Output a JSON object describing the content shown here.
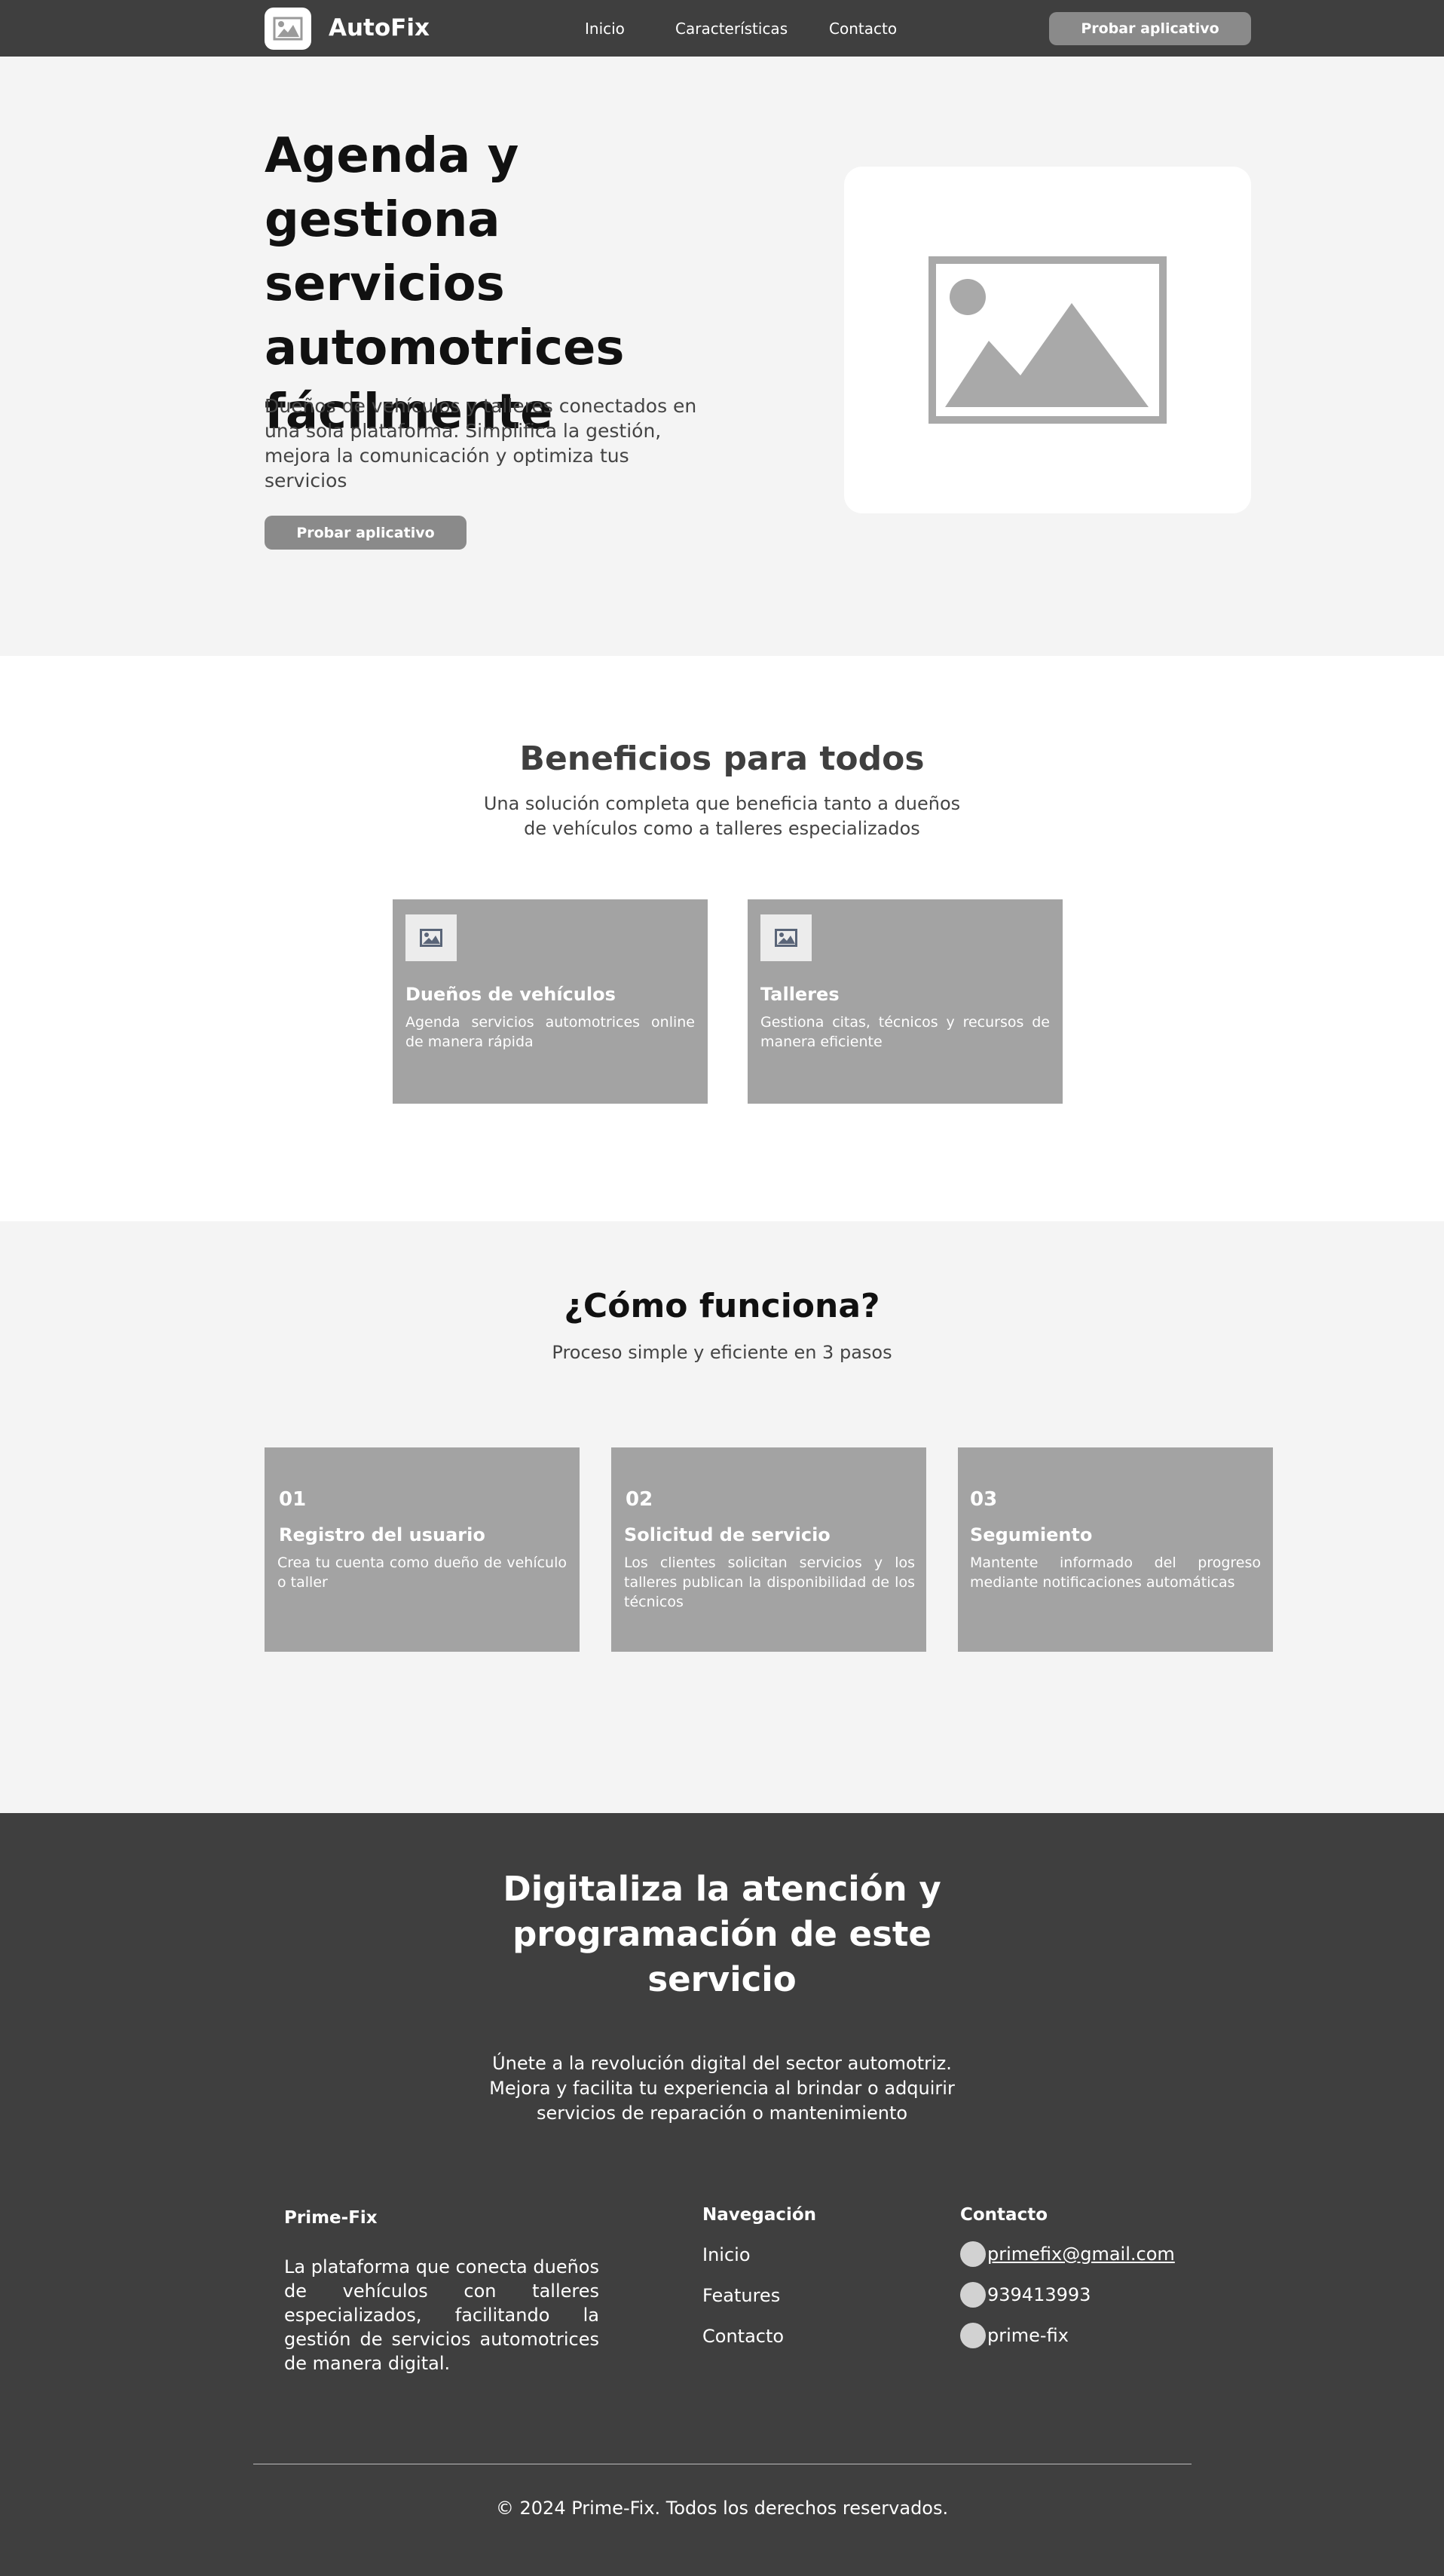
{
  "nav": {
    "brand": "AutoFix",
    "links": [
      "Inicio",
      "Características",
      "Contacto"
    ],
    "cta": "Probar aplicativo"
  },
  "hero": {
    "title": "Agenda y gestiona servicios automotrices fácilmente",
    "description": "Dueños de vehículos y talleres conectados en una sola plataforma. Simplifica la gestión, mejora la comunicación y optimiza tus servicios",
    "cta": "Probar aplicativo",
    "image_icon": "image-placeholder-icon"
  },
  "benefits": {
    "title": "Beneficios para todos",
    "subtitle": "Una solución completa que beneficia tanto a dueños de vehículos como a talleres especializados",
    "cards": [
      {
        "title": "Dueños de vehículos",
        "text": "Agenda servicios automotrices online de manera rápida",
        "icon": "image-icon"
      },
      {
        "title": "Talleres",
        "text": "Gestiona citas, técnicos y recursos de manera eficiente",
        "icon": "image-icon"
      }
    ]
  },
  "how": {
    "title": "¿Cómo funciona?",
    "subtitle": "Proceso simple y eficiente en 3 pasos",
    "steps": [
      {
        "num": "01",
        "title": "Registro del usuario",
        "text": "Crea tu cuenta como dueño de vehículo o taller"
      },
      {
        "num": "02",
        "title": "Solicitud de servicio",
        "text": "Los clientes solicitan servicios y los talleres publican la disponibilidad de los técnicos"
      },
      {
        "num": "03",
        "title": "Segumiento",
        "text": "Mantente informado del progreso mediante notificaciones automáticas"
      }
    ]
  },
  "cta": {
    "title": "Digitaliza la atención y programación de este servicio",
    "text": "Únete a la revolución digital del sector automotriz. Mejora y facilita tu experiencia al brindar o adquirir servicios de reparación o mantenimiento"
  },
  "footer": {
    "brand": "Prime-Fix",
    "about": "La plataforma que conecta dueños de vehículos con talleres especializados, facilitando la gestión de servicios automotrices de manera digital.",
    "nav_title": "Navegación",
    "nav_links": [
      "Inicio",
      "Features",
      "Contacto"
    ],
    "contact_title": "Contacto",
    "contact": {
      "email": "primefix@gmail.com",
      "phone": "939413993",
      "social": "prime-fix"
    },
    "copyright": "© 2024 Prime-Fix. Todos los derechos reservados."
  },
  "colors": {
    "dark": "#3f3f3f",
    "light_bg": "#f4f4f4",
    "card": "#a3a3a3",
    "button": "#8a8a8a"
  }
}
